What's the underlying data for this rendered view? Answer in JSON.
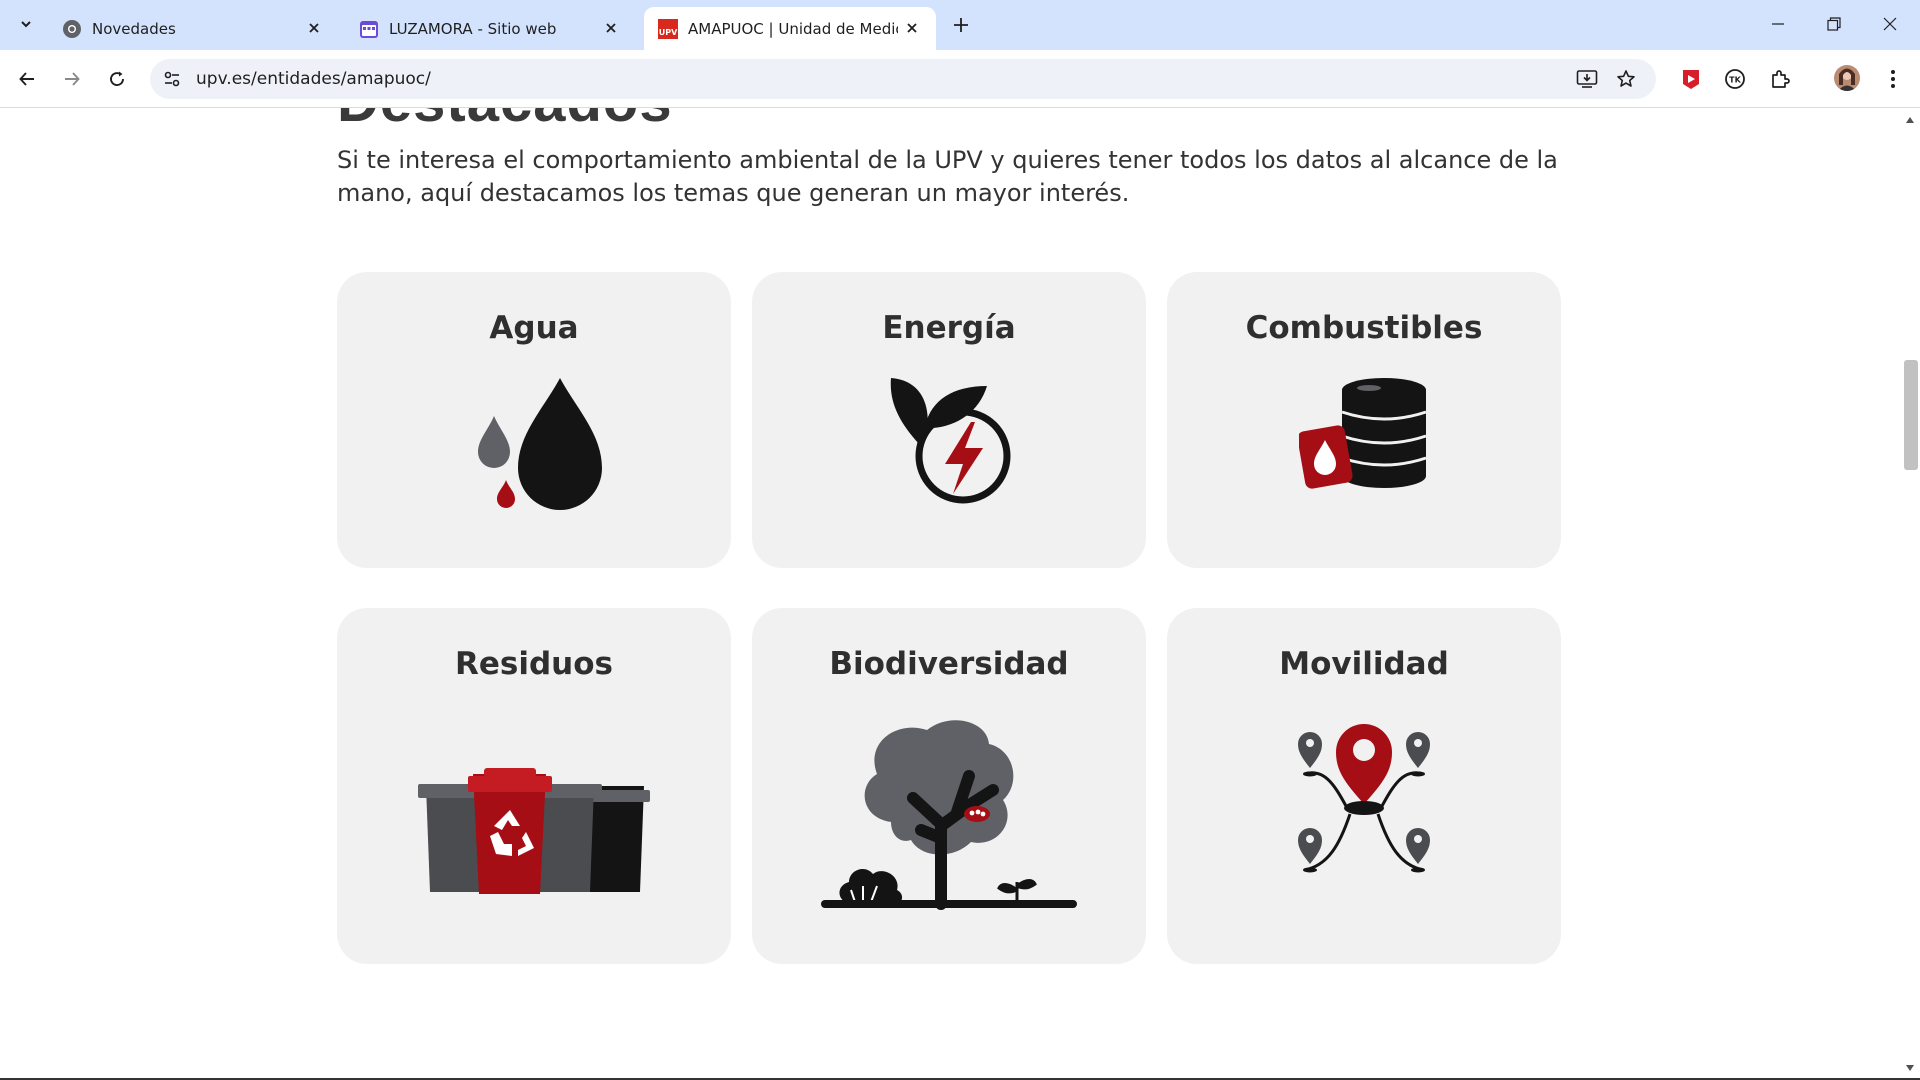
{
  "browser": {
    "tabs": [
      {
        "title": "Novedades",
        "icon": "chrome-icon"
      },
      {
        "title": "LUZAMORA - Sitio web",
        "icon": "calendar-app-icon"
      },
      {
        "title": "AMAPUOC | Unidad de Medio Ambiente",
        "icon": "upv-icon",
        "active": true
      }
    ],
    "url": "upv.es/entidades/amapuoc/"
  },
  "page": {
    "heading_partial": "Destacados",
    "intro": "Si te interesa el comportamiento ambiental de la UPV y quieres tener todos los datos al alcance de la mano, aquí destacamos los temas que generan un mayor interés.",
    "cards": [
      {
        "title": "Agua",
        "icon": "water-drops-icon"
      },
      {
        "title": "Energía",
        "icon": "leaf-lightning-icon"
      },
      {
        "title": "Combustibles",
        "icon": "fuel-barrel-icon"
      },
      {
        "title": "Residuos",
        "icon": "recycling-bins-icon"
      },
      {
        "title": "Biodiversidad",
        "icon": "tree-icon"
      },
      {
        "title": "Movilidad",
        "icon": "map-pins-icon"
      }
    ]
  },
  "colors": {
    "accent": "#a50e14",
    "dark": "#141414",
    "gray": "#5f6166",
    "card": "#f1f1f1"
  }
}
